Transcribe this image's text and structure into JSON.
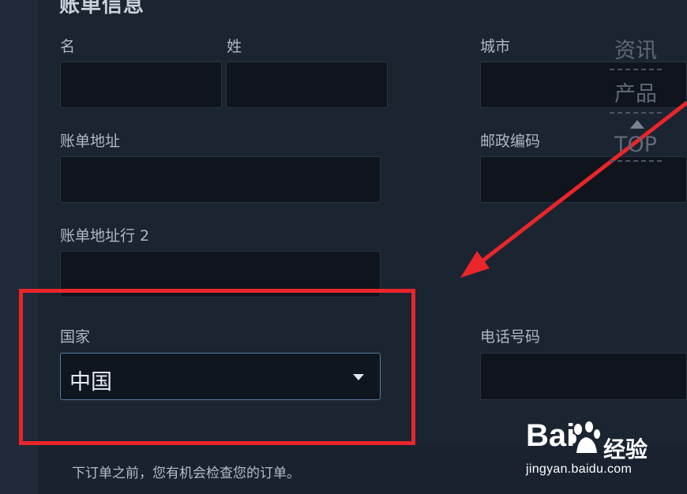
{
  "form": {
    "section_title": "账单信息",
    "first_name_label": "名",
    "last_name_label": "姓",
    "city_label": "城市",
    "address_label": "账单地址",
    "postal_label": "邮政编码",
    "address2_label": "账单地址行 2",
    "country_label": "国家",
    "country_value": "中国",
    "phone_label": "电话号码",
    "note": "下订单之前，您有机会检查您的订单。"
  },
  "float_nav": {
    "item_news": "资讯",
    "item_products": "产品",
    "item_top": "TOP"
  },
  "watermark": {
    "brand": "Bai",
    "brand_suffix": "经验",
    "url": "jingyan.baidu.com"
  },
  "annotation": {
    "highlight_color": "#e8262b"
  }
}
